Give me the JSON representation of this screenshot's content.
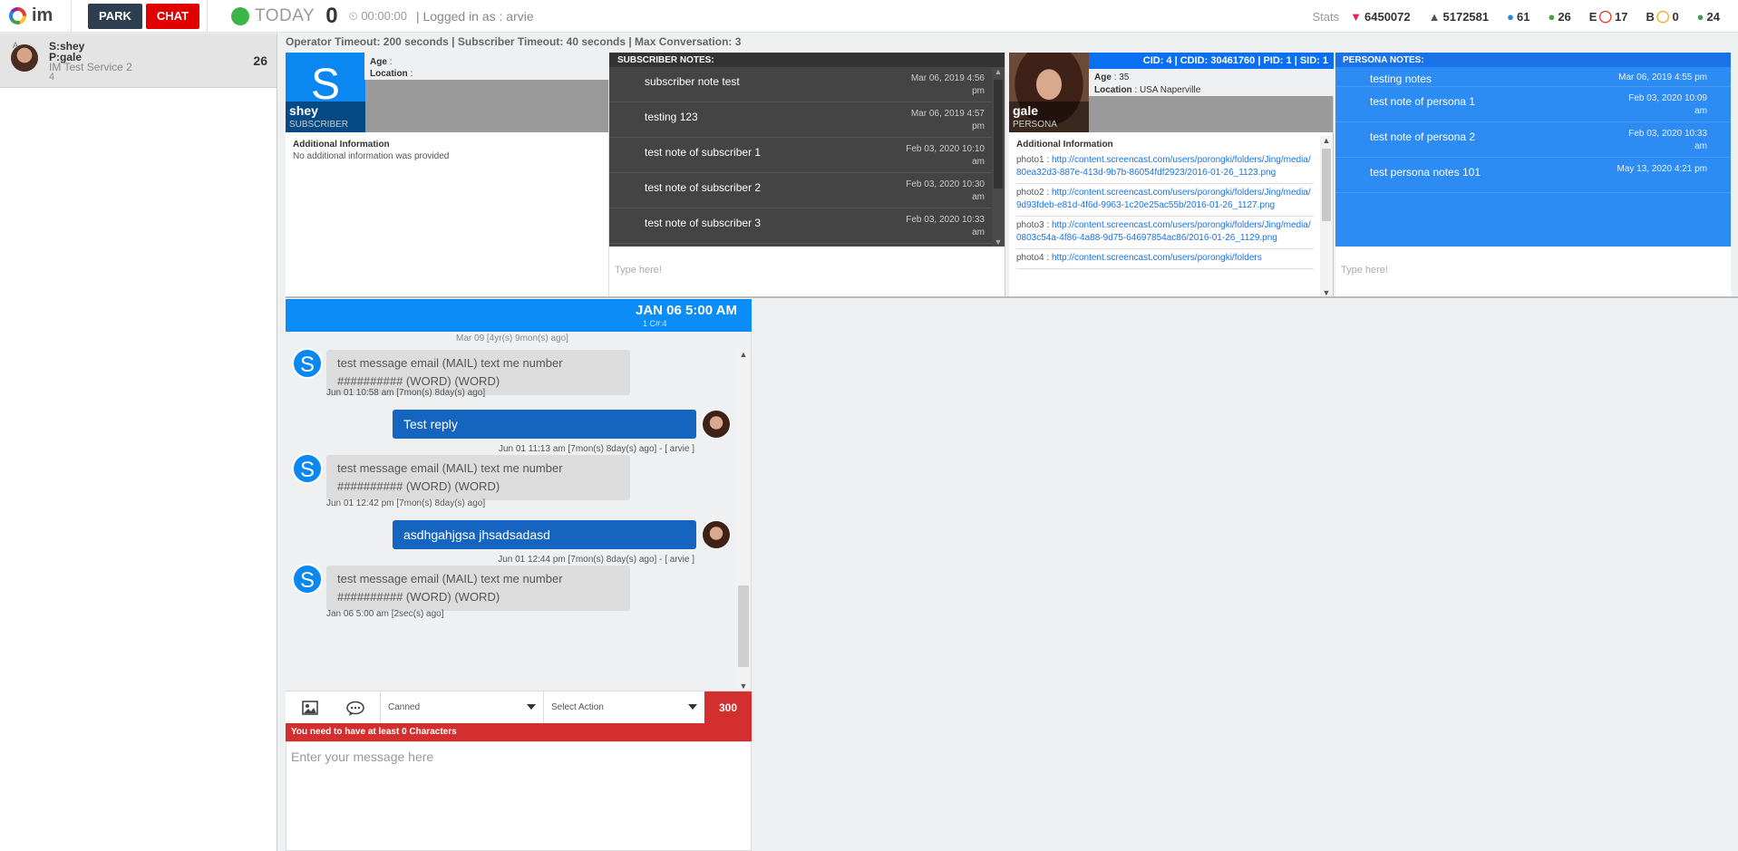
{
  "app": {
    "logo_text": "im"
  },
  "topbar": {
    "park_label": "PARK",
    "chat_label": "CHAT",
    "today_label": "TODAY",
    "today_count": "0",
    "timer": "⏲ 00:00:00",
    "login_text": "| Logged in as : arvie",
    "stats_label": "Stats",
    "stats": [
      {
        "icon": "heart-down-icon",
        "glyph": "▼",
        "color": "#e91e63",
        "value": "6450072"
      },
      {
        "icon": "arrow-up-icon",
        "glyph": "▲",
        "color": "#555555",
        "value": "5172581"
      },
      {
        "icon": "user-blue-icon",
        "glyph": "●",
        "color": "#1e88e5",
        "value": "61"
      },
      {
        "icon": "user-green-icon",
        "glyph": "●",
        "color": "#43a047",
        "value": "26"
      },
      {
        "prefix": "E",
        "icon": "chat-red-icon",
        "glyph": "◯",
        "color": "#e53935",
        "value": "17"
      },
      {
        "prefix": "B",
        "icon": "chat-yellow-icon",
        "glyph": "◯",
        "color": "#f9a825",
        "value": "0"
      },
      {
        "icon": "chat-green-icon",
        "glyph": "●",
        "color": "#43a047",
        "value": "24"
      }
    ]
  },
  "queue": [
    {
      "avatar_label": "A",
      "s": "S:shey",
      "p": "P:gale",
      "service": "IM Test Service 2",
      "num": "4",
      "count": "26"
    }
  ],
  "timeouts": "Operator Timeout: 200 seconds | Subscriber Timeout: 40 seconds | Max Conversation: 3",
  "subscriber": {
    "letter": "S",
    "name": "shey",
    "role": "SUBSCRIBER",
    "age_label": "Age",
    "age": ":",
    "location_label": "Location",
    "location": ":",
    "addl_title": "Additional Information",
    "addl_text": "No additional information was provided"
  },
  "subscriber_notes": {
    "title": "SUBSCRIBER NOTES:",
    "placeholder": "Type here!",
    "items": [
      {
        "text": "subscriber note test",
        "date": "Mar 06, 2019 4:56 pm"
      },
      {
        "text": "testing 123",
        "date": "Mar 06, 2019 4:57 pm"
      },
      {
        "text": "test note of subscriber 1",
        "date": "Feb 03, 2020 10:10 am"
      },
      {
        "text": "test note of subscriber 2",
        "date": "Feb 03, 2020 10:30 am"
      },
      {
        "text": "test note of subscriber 3",
        "date": "Feb 03, 2020 10:33 am"
      }
    ]
  },
  "persona": {
    "ids": "CID: 4 | CDID: 30461760 | PID: 1 | SID: 1",
    "name": "gale",
    "role": "PERSONA",
    "age_label": "Age",
    "age": ": 35",
    "location_label": "Location",
    "location": ": USA Naperville",
    "addl_title": "Additional Information",
    "photos": [
      {
        "label": "photo1 :",
        "url": "http://content.screencast.com/users/porongki/folders/Jing/media/80ea32d3-887e-413d-9b7b-86054fdf2923/2016-01-26_1123.png"
      },
      {
        "label": "photo2 :",
        "url": "http://content.screencast.com/users/porongki/folders/Jing/media/9d93fdeb-e81d-4f6d-9963-1c20e25ac55b/2016-01-26_1127.png"
      },
      {
        "label": "photo3 :",
        "url": "http://content.screencast.com/users/porongki/folders/Jing/media/0803c54a-4f86-4a88-9d75-64697854ac86/2016-01-26_1129.png"
      },
      {
        "label": "photo4 :",
        "url": "http://content.screencast.com/users/porongki/folders"
      }
    ]
  },
  "persona_notes": {
    "title": "PERSONA NOTES:",
    "placeholder": "Type here!",
    "items": [
      {
        "text": "testing notes",
        "date": "Mar 06, 2019 4:55 pm"
      },
      {
        "text": "test note of persona 1",
        "date": "Feb 03, 2020 10:09 am"
      },
      {
        "text": "test note of persona 2",
        "date": "Feb 03, 2020 10:33 am"
      },
      {
        "text": "test persona notes 101",
        "date": "May 13, 2020 4:21 pm"
      }
    ]
  },
  "chat": {
    "header_date": "JAN 06 5:00 AM",
    "header_sub": "1 C#:4",
    "top_stamp": "Mar 09 [4yr(s) 9mon(s) ago]",
    "messages": [
      {
        "dir": "in",
        "avatar": "S",
        "text": "test message email (MAIL) text me number ########## (WORD) (WORD)",
        "stamp": "Jun 01 10:58 am [7mon(s) 8day(s) ago]"
      },
      {
        "dir": "out",
        "text": "Test reply",
        "stamp": "Jun 01 11:13 am [7mon(s) 8day(s) ago] - [ arvie ]"
      },
      {
        "dir": "in",
        "avatar": "S",
        "text": "test message email (MAIL) text me number ########## (WORD) (WORD)",
        "stamp": "Jun 01 12:42 pm [7mon(s) 8day(s) ago]"
      },
      {
        "dir": "out",
        "text": "asdhgahjgsa jhsadsadasd",
        "stamp": "Jun 01 12:44 pm [7mon(s) 8day(s) ago] - [ arvie ]"
      },
      {
        "dir": "in",
        "avatar": "S",
        "text": "test message email (MAIL) text me number ########## (WORD) (WORD)",
        "stamp": "Jan 06 5:00 am [2sec(s) ago]"
      }
    ],
    "canned_label": "Canned",
    "action_label": "Select Action",
    "char_count": "300",
    "warning": "You need to have at least 0 Characters",
    "input_placeholder": "Enter your message here"
  }
}
